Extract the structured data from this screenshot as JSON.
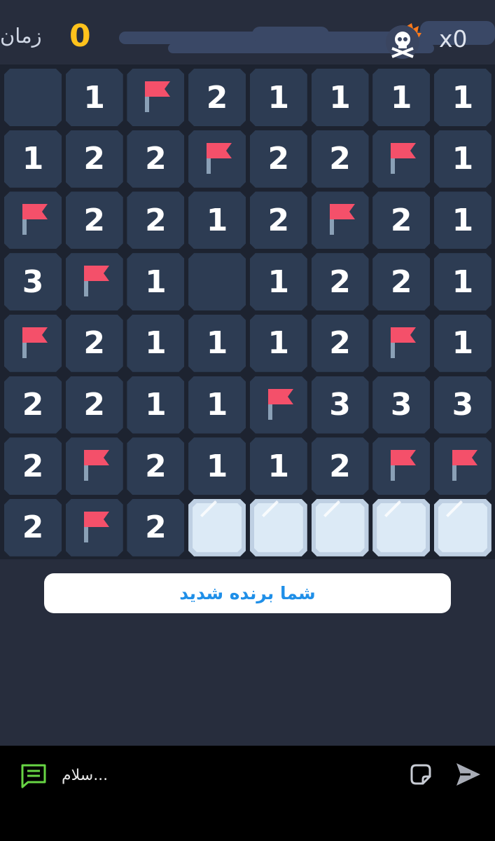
{
  "header": {
    "timer_label": "زمان",
    "timer_value": "0",
    "multiplier": "x0",
    "skull_icon": "skull-crossbones-icon"
  },
  "board": {
    "rows": [
      [
        "",
        "1",
        "F",
        "2",
        "1",
        "1",
        "1",
        "1"
      ],
      [
        "1",
        "2",
        "2",
        "F",
        "2",
        "2",
        "F",
        "1"
      ],
      [
        "F",
        "2",
        "2",
        "1",
        "2",
        "F",
        "2",
        "1"
      ],
      [
        "3",
        "F",
        "1",
        "",
        "1",
        "2",
        "2",
        "1"
      ],
      [
        "F",
        "2",
        "1",
        "1",
        "1",
        "2",
        "F",
        "1"
      ],
      [
        "2",
        "2",
        "1",
        "1",
        "F",
        "3",
        "3",
        "3"
      ],
      [
        "2",
        "F",
        "2",
        "1",
        "1",
        "2",
        "F",
        "F"
      ],
      [
        "2",
        "F",
        "2",
        "C",
        "C",
        "C",
        "C",
        "C"
      ]
    ],
    "colors": {
      "cell": "#2d3c53",
      "covered": "#dceaf6",
      "flag": "#f4506a",
      "flag_pole": "#8aa0b6"
    }
  },
  "result": {
    "message": "شما برنده شدید"
  },
  "chat": {
    "input_value": "سلام...",
    "icons": [
      "chat-icon",
      "sticker-icon",
      "send-icon"
    ]
  }
}
